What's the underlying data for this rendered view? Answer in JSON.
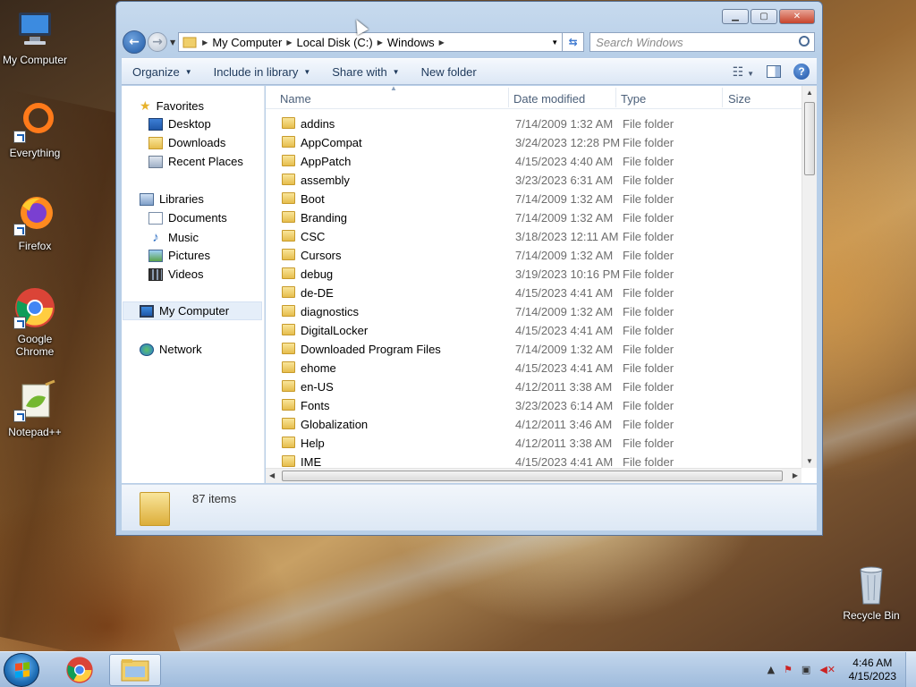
{
  "desktop": {
    "icons": [
      {
        "label": "My Computer"
      },
      {
        "label": "Everything"
      },
      {
        "label": "Firefox"
      },
      {
        "label": "Google Chrome"
      },
      {
        "label": "Notepad++"
      },
      {
        "label": "Recycle Bin"
      }
    ]
  },
  "window": {
    "address": {
      "crumbs": [
        "My Computer",
        "Local Disk (C:)",
        "Windows"
      ]
    },
    "search": {
      "placeholder": "Search Windows"
    },
    "toolbar": {
      "organize": "Organize",
      "include": "Include in library",
      "share": "Share with",
      "new_folder": "New folder"
    },
    "nav": {
      "favorites": "Favorites",
      "desktop": "Desktop",
      "downloads": "Downloads",
      "recent": "Recent Places",
      "libraries": "Libraries",
      "documents": "Documents",
      "music": "Music",
      "pictures": "Pictures",
      "videos": "Videos",
      "computer": "My Computer",
      "network": "Network"
    },
    "columns": {
      "name": "Name",
      "date": "Date modified",
      "type": "Type",
      "size": "Size"
    },
    "files": [
      {
        "name": "addins",
        "date": "7/14/2009 1:32 AM",
        "type": "File folder"
      },
      {
        "name": "AppCompat",
        "date": "3/24/2023 12:28 PM",
        "type": "File folder"
      },
      {
        "name": "AppPatch",
        "date": "4/15/2023 4:40 AM",
        "type": "File folder"
      },
      {
        "name": "assembly",
        "date": "3/23/2023 6:31 AM",
        "type": "File folder"
      },
      {
        "name": "Boot",
        "date": "7/14/2009 1:32 AM",
        "type": "File folder"
      },
      {
        "name": "Branding",
        "date": "7/14/2009 1:32 AM",
        "type": "File folder"
      },
      {
        "name": "CSC",
        "date": "3/18/2023 12:11 AM",
        "type": "File folder"
      },
      {
        "name": "Cursors",
        "date": "7/14/2009 1:32 AM",
        "type": "File folder"
      },
      {
        "name": "debug",
        "date": "3/19/2023 10:16 PM",
        "type": "File folder"
      },
      {
        "name": "de-DE",
        "date": "4/15/2023 4:41 AM",
        "type": "File folder"
      },
      {
        "name": "diagnostics",
        "date": "7/14/2009 1:32 AM",
        "type": "File folder"
      },
      {
        "name": "DigitalLocker",
        "date": "4/15/2023 4:41 AM",
        "type": "File folder"
      },
      {
        "name": "Downloaded Program Files",
        "date": "7/14/2009 1:32 AM",
        "type": "File folder"
      },
      {
        "name": "ehome",
        "date": "4/15/2023 4:41 AM",
        "type": "File folder"
      },
      {
        "name": "en-US",
        "date": "4/12/2011 3:38 AM",
        "type": "File folder"
      },
      {
        "name": "Fonts",
        "date": "3/23/2023 6:14 AM",
        "type": "File folder"
      },
      {
        "name": "Globalization",
        "date": "4/12/2011 3:46 AM",
        "type": "File folder"
      },
      {
        "name": "Help",
        "date": "4/12/2011 3:38 AM",
        "type": "File folder"
      },
      {
        "name": "IME",
        "date": "4/15/2023 4:41 AM",
        "type": "File folder"
      }
    ],
    "status": {
      "count": "87 items"
    }
  },
  "taskbar": {
    "time": "4:46 AM",
    "date": "4/15/2023"
  }
}
